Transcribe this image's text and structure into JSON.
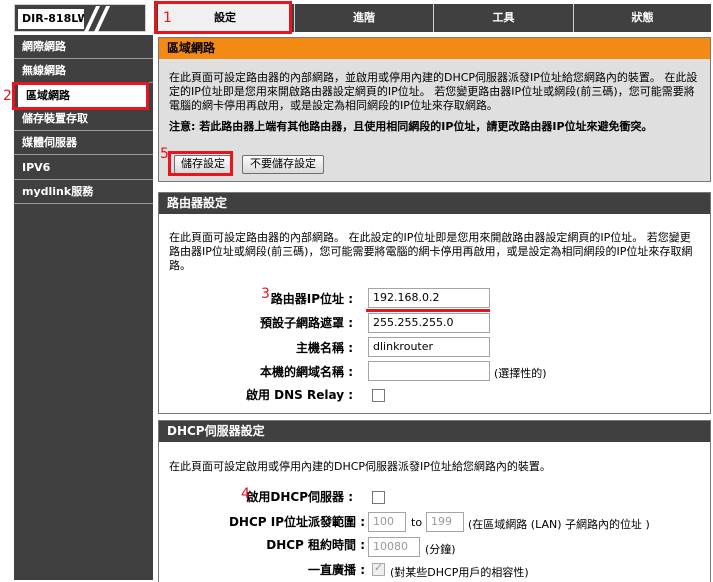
{
  "logo": {
    "text": "DIR-818LW"
  },
  "tabs": [
    {
      "label": "設定",
      "active": true
    },
    {
      "label": "進階",
      "active": false
    },
    {
      "label": "工具",
      "active": false
    },
    {
      "label": "狀態",
      "active": false
    }
  ],
  "sidebar": {
    "items": [
      {
        "label": "網際網路"
      },
      {
        "label": "無線網路"
      },
      {
        "label": "區域網路",
        "active": true
      },
      {
        "label": "儲存裝置存取"
      },
      {
        "label": "媒體伺服器"
      },
      {
        "label": "IPV6"
      },
      {
        "label": "mydlink服務"
      }
    ]
  },
  "lan_panel": {
    "title": "區域網路",
    "description": "在此頁面可設定路由器的內部網路，並啟用或停用內建的DHCP伺服器派發IP位址給您網路內的裝置。 在此設定的IP位址即是您用來開啟路由器設定網頁的IP位址。 若您變更路由器IP位址或網段(前三碼)，您可能需要將電腦的網卡停用再啟用，或是設定為相同網段的IP位址來存取網路。",
    "warning": "注意: 若此路由器上端有其他路由器，且使用相同網段的IP位址，請更改路由器IP位址來避免衝突。",
    "save_button": "儲存設定",
    "cancel_button": "不要儲存設定"
  },
  "router_panel": {
    "title": "路由器設定",
    "description": "在此頁面可設定路由器的內部網路。 在此設定的IP位址即是您用來開啟路由器設定網頁的IP位址。 若您變更路由器IP位址或網段(前三碼)，您可能需要將電腦的網卡停用再啟用，或是設定為相同網段的IP位址來存取網路。",
    "ip_label": "路由器IP位址 :",
    "ip_value": "192.168.0.2",
    "subnet_label": "預設子網路遮罩 :",
    "subnet_value": "255.255.255.0",
    "hostname_label": "主機名稱 :",
    "hostname_value": "dlinkrouter",
    "domain_label": "本機的網域名稱 :",
    "domain_value": "",
    "domain_optional": "(選擇性的)",
    "dns_relay_label": "啟用 DNS Relay :"
  },
  "dhcp_panel": {
    "title": "DHCP伺服器設定",
    "description": "在此頁面可設定啟用或停用內建的DHCP伺服器派發IP位址給您網路內的裝置。",
    "enable_label": "啟用DHCP伺服器 :",
    "range_label": "DHCP IP位址派發範圍 :",
    "range_start": "100",
    "range_to": "to",
    "range_end": "199",
    "range_note": "(在區域網路 (LAN) 子網路內的位址 )",
    "lease_label": "DHCP 租約時間 :",
    "lease_value": "10080",
    "lease_unit": "(分鐘)",
    "broadcast_label": "一直廣播 :",
    "broadcast_note": "(對某些DHCP用戶的相容性)"
  },
  "annotations": {
    "colors": {
      "accent": "#e8141e",
      "tab_bar": "#404040",
      "panel_header_orange": "#f28a14"
    },
    "markers": [
      "1",
      "2",
      "3",
      "4",
      "5"
    ]
  }
}
